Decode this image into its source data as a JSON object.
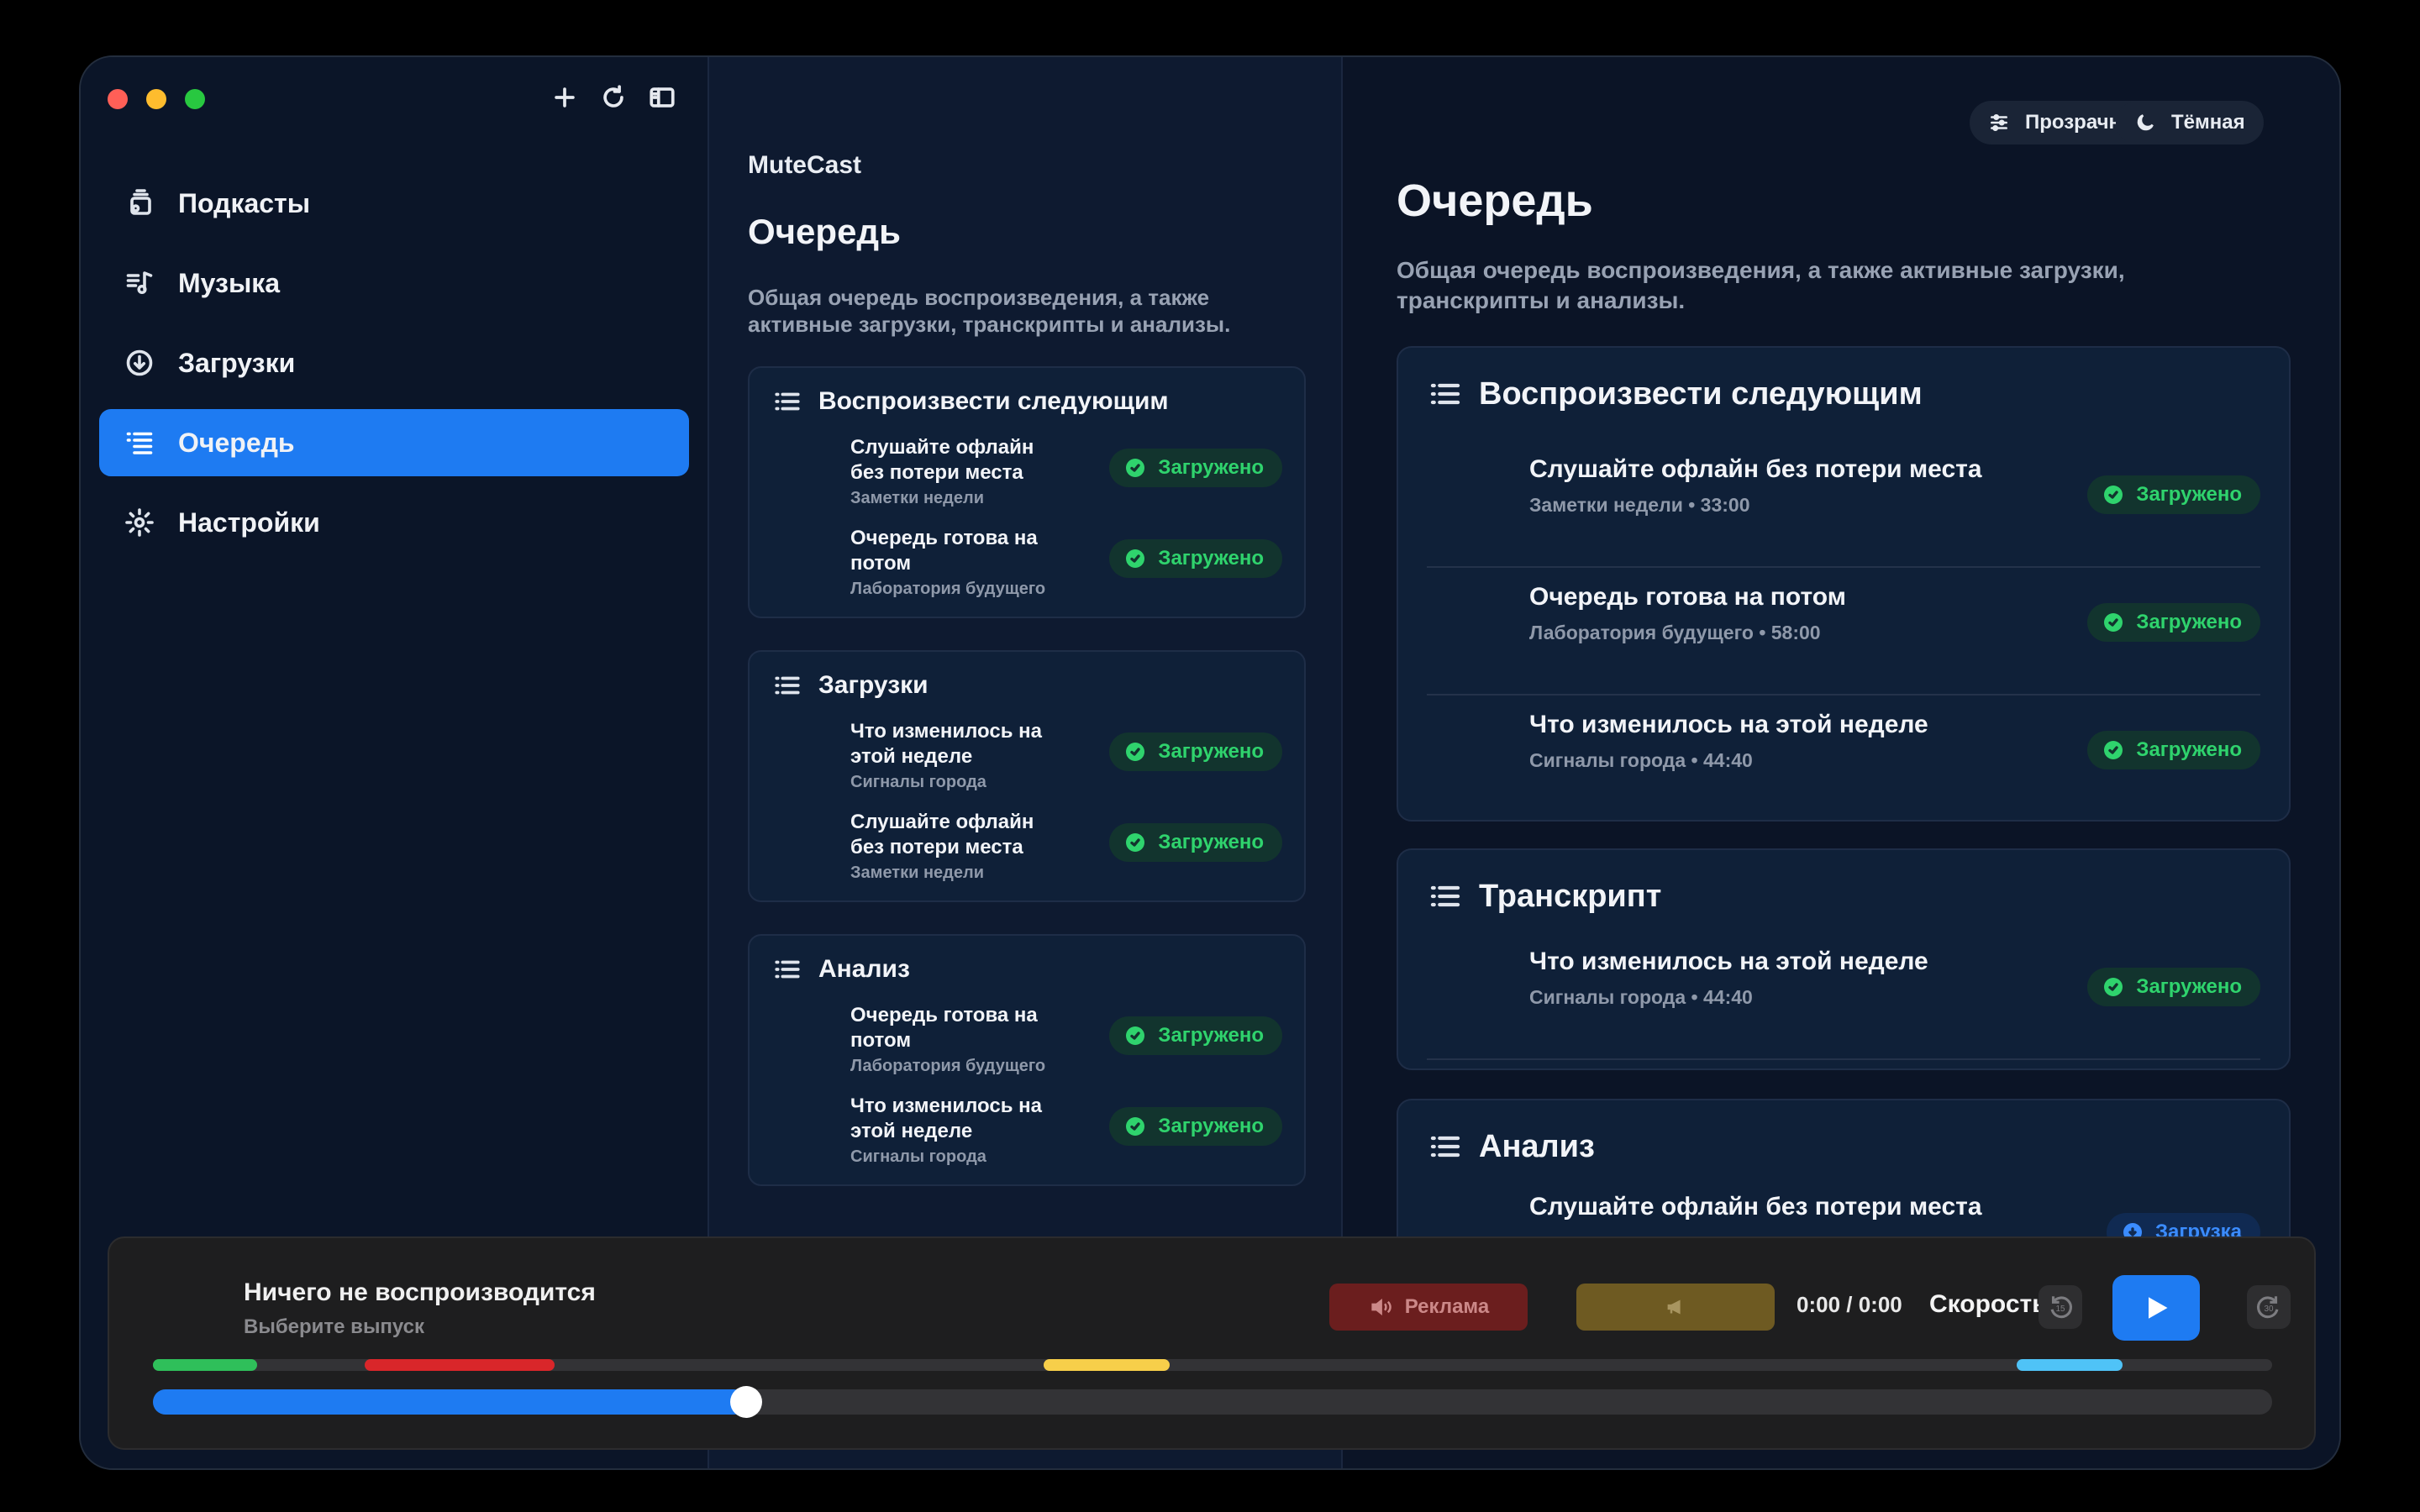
{
  "sidebar": {
    "items": [
      {
        "label": "Подкасты",
        "icon": "podcasts-icon",
        "active": false
      },
      {
        "label": "Музыка",
        "icon": "music-icon",
        "active": false
      },
      {
        "label": "Загрузки",
        "icon": "download-icon",
        "active": false
      },
      {
        "label": "Очередь",
        "icon": "queue-icon",
        "active": true
      },
      {
        "label": "Настройки",
        "icon": "gear-icon",
        "active": false
      }
    ]
  },
  "middle": {
    "brand": "MuteCast",
    "title": "Очередь",
    "description": "Общая очередь воспроизведения, а также активные загрузки, транскрипты и анализы.",
    "sections": [
      {
        "title": "Воспроизвести следующим",
        "rows": [
          {
            "title": "Слушайте офлайн без потери места",
            "subtitle": "Заметки недели",
            "status": "Загружено"
          },
          {
            "title": "Очередь готова на потом",
            "subtitle": "Лаборатория будущего",
            "status": "Загружено"
          }
        ]
      },
      {
        "title": "Загрузки",
        "rows": [
          {
            "title": "Что изменилось на этой неделе",
            "subtitle": "Сигналы города",
            "status": "Загружено"
          },
          {
            "title": "Слушайте офлайн без потери места",
            "subtitle": "Заметки недели",
            "status": "Загружено"
          }
        ]
      },
      {
        "title": "Анализ",
        "rows": [
          {
            "title": "Очередь готова на потом",
            "subtitle": "Лаборатория будущего",
            "status": "Загружено"
          },
          {
            "title": "Что изменилось на этой неделе",
            "subtitle": "Сигналы города",
            "status": "Загружено"
          }
        ]
      }
    ]
  },
  "right": {
    "transparency_label": "Прозрачность",
    "theme_label": "Тёмная",
    "title": "Очередь",
    "description": "Общая очередь воспроизведения, а также активные загрузки, транскрипты и анализы.",
    "sections": [
      {
        "title": "Воспроизвести следующим",
        "rows": [
          {
            "title": "Слушайте офлайн без потери места",
            "subtitle": "Заметки недели • 33:00",
            "status": "Загружено"
          },
          {
            "title": "Очередь готова на потом",
            "subtitle": "Лаборатория будущего • 58:00",
            "status": "Загружено"
          },
          {
            "title": "Что изменилось на этой неделе",
            "subtitle": "Сигналы города • 44:40",
            "status": "Загружено"
          }
        ]
      },
      {
        "title": "Транскрипт",
        "rows": [
          {
            "title": "Что изменилось на этой неделе",
            "subtitle": "Сигналы города • 44:40",
            "status": "Загружено"
          }
        ]
      },
      {
        "title": "Анализ",
        "rows": [
          {
            "title": "Слушайте офлайн без потери места",
            "subtitle": "",
            "status": "Загрузка"
          }
        ]
      }
    ]
  },
  "player": {
    "title": "Ничего не воспроизводится",
    "subtitle": "Выберите выпуск",
    "ad_label": "Реклама",
    "time": "0:00 / 0:00",
    "speed_label": "Скорость",
    "skip_back_seconds": "15",
    "skip_forward_seconds": "30",
    "progress": 0.28,
    "segment_colors": [
      "#2fbf5a",
      "#d9262a",
      "#f7cf4a",
      "#4fc3f7"
    ],
    "accent": "#1e7bf2"
  }
}
